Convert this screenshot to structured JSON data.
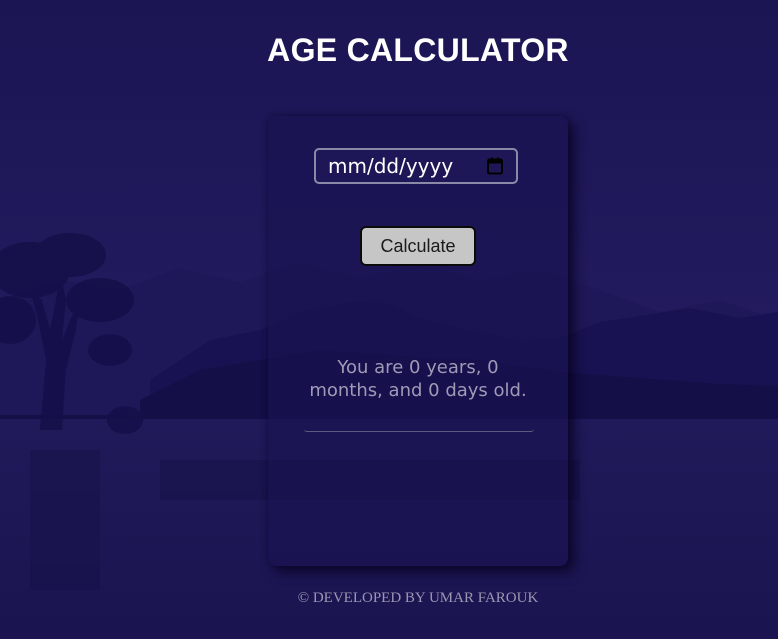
{
  "page": {
    "title": "AGE CALCULATOR",
    "footer": "© DEVELOPED BY UMAR FAROUK"
  },
  "form": {
    "date_placeholder": "mm/dd/yyyy",
    "calendar_icon": "calendar-icon",
    "calculate_label": "Calculate"
  },
  "result": {
    "text": "You are 0 years, 0 months, and 0 days old."
  },
  "colors": {
    "background": "#1b1452",
    "title": "#ffffff",
    "button_bg": "#c6c6c6",
    "result_text": "#9e9bb6"
  }
}
